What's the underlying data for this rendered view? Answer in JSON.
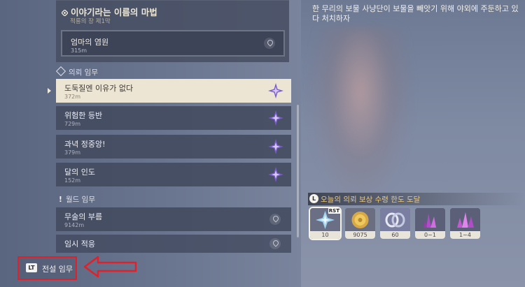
{
  "header_text": "한 무리의 보물 사냥단이 보물을 빼앗기 위해 야외에 주둔하고 있다 처치하자",
  "main_quest": {
    "title": "이야기라는 이름의 마법",
    "chapter": "적룡의 장 제1막",
    "sub_quest": {
      "name": "엄마의 염원",
      "distance": "315m"
    }
  },
  "commission_section": {
    "label": "의뢰 임무"
  },
  "commission_quests": [
    {
      "name": "도둑질엔 이유가 없다",
      "distance": "372m",
      "selected": true
    },
    {
      "name": "위험한 등반",
      "distance": "729m",
      "selected": false
    },
    {
      "name": "과녁 정중앙!",
      "distance": "379m",
      "selected": false
    },
    {
      "name": "달의 인도",
      "distance": "152m",
      "selected": false
    }
  ],
  "world_section": {
    "label": "월드 임무"
  },
  "world_quests": [
    {
      "name": "무술의 부름",
      "distance": "9142m"
    },
    {
      "name": "임시 적응",
      "distance": ""
    }
  ],
  "reward_banner": {
    "icon": "L",
    "text": "오늘의 의뢰 보상 수령 한도 도달"
  },
  "rewards": [
    {
      "icon": "primogem-star-icon",
      "count": "10",
      "badge": "RST"
    },
    {
      "icon": "mora-coin-icon",
      "count": "9075"
    },
    {
      "icon": "fate-ring-icon",
      "count": "60"
    },
    {
      "icon": "crystal-icon",
      "count": "0~1"
    },
    {
      "icon": "crystal-cluster-icon",
      "count": "1~4"
    }
  ],
  "legend_button": {
    "key": "LT",
    "label": "전설 임무"
  },
  "colors": {
    "accent_gold": "#f0c877",
    "highlight_red": "#e0202a",
    "selected_row": "#ece5d3"
  }
}
